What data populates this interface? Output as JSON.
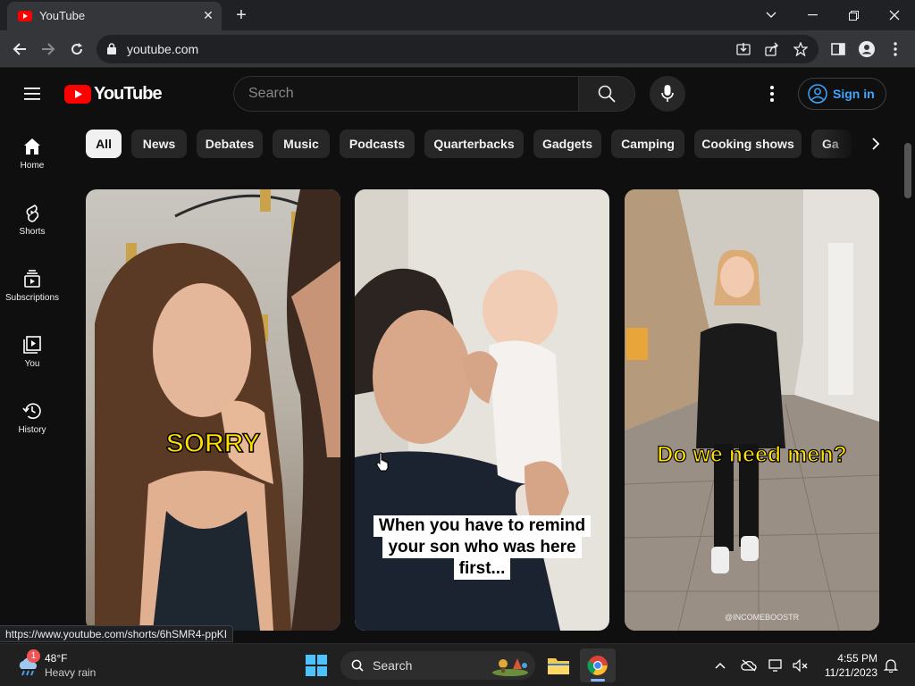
{
  "browser": {
    "tab_title": "YouTube",
    "url": "youtube.com",
    "status_url": "https://www.youtube.com/shorts/6hSMR4-ppKI"
  },
  "masthead": {
    "logo_text": "YouTube",
    "search_placeholder": "Search",
    "signin_label": "Sign in"
  },
  "sidebar": {
    "items": [
      {
        "label": "Home",
        "icon": "home-icon"
      },
      {
        "label": "Shorts",
        "icon": "shorts-icon"
      },
      {
        "label": "Subscriptions",
        "icon": "subscriptions-icon"
      },
      {
        "label": "You",
        "icon": "you-icon"
      },
      {
        "label": "History",
        "icon": "history-icon"
      }
    ]
  },
  "chips": [
    "All",
    "News",
    "Debates",
    "Music",
    "Podcasts",
    "Quarterbacks",
    "Gadgets",
    "Camping",
    "Cooking shows",
    "Ga"
  ],
  "shorts": [
    {
      "caption": "SORRY"
    },
    {
      "caption_lines": [
        "When you have to remind",
        "your son who was here",
        "first..."
      ]
    },
    {
      "caption": "Do we need men?",
      "watermark": "@INCOMEBOOSTR"
    }
  ],
  "taskbar": {
    "weather_temp": "48°F",
    "weather_condition": "Heavy rain",
    "weather_badge": "1",
    "search_label": "Search",
    "time": "4:55 PM",
    "date": "11/21/2023"
  },
  "colors": {
    "youtube_red": "#ff0000",
    "signin_blue": "#3ea6ff",
    "caption_yellow": "#ffe100"
  }
}
